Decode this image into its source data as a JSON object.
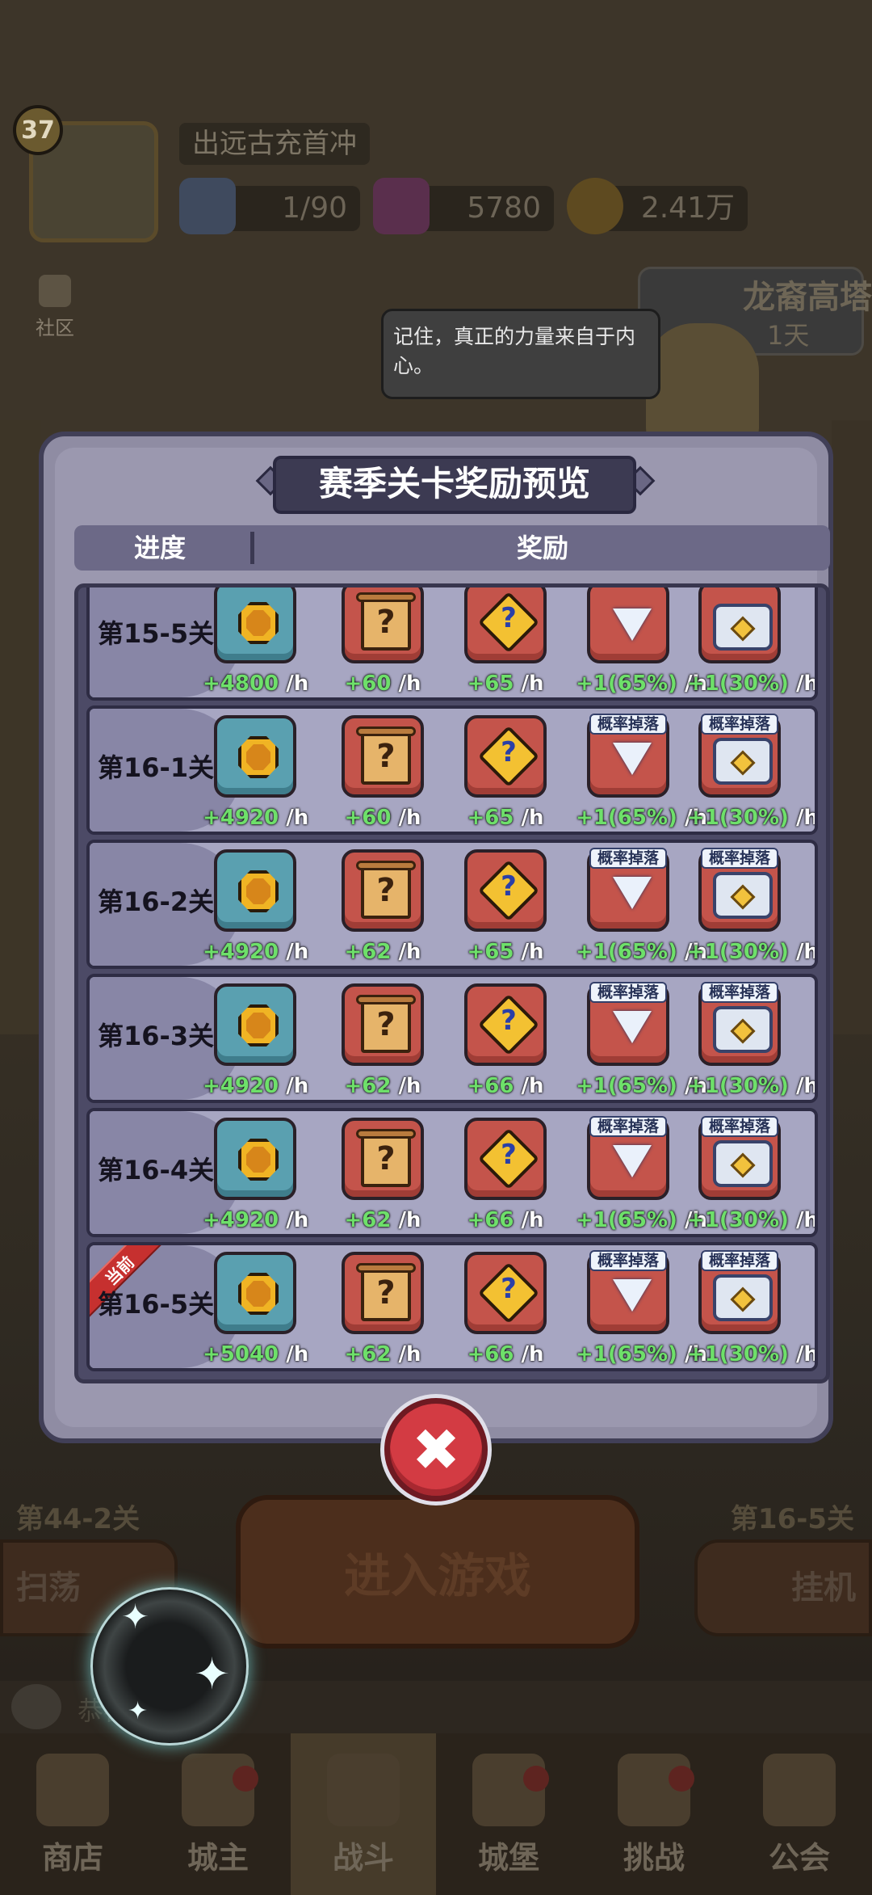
{
  "background": {
    "player_level": "37",
    "player_name": "出远古充首冲",
    "energy": "1/90",
    "gems": "5780",
    "gold": "2.41万",
    "community_label": "社区",
    "tower_name": "龙裔高塔",
    "tower_days": "1天",
    "speech": "记住，真正的力量来自于内心。",
    "stage_left": "第44-2关",
    "stage_right": "第16-5关",
    "sweep_label": "扫荡",
    "enter_label": "进入游戏",
    "idle_label": "挂机",
    "chat_text": "恭喜...新纪元"
  },
  "modal": {
    "title": "赛季关卡奖励预览",
    "col_progress": "进度",
    "col_reward": "奖励",
    "prob_tag": "概率掉落",
    "unit": "/h",
    "current_tag": "当前",
    "rows": [
      {
        "stage": "第15-5关",
        "gold": "+4800",
        "scroll": "+60",
        "puzzle": "+65",
        "gem": "+1(65%)",
        "chest": "+1(30%)"
      },
      {
        "stage": "第16-1关",
        "gold": "+4920",
        "scroll": "+60",
        "puzzle": "+65",
        "gem": "+1(65%)",
        "chest": "+1(30%)"
      },
      {
        "stage": "第16-2关",
        "gold": "+4920",
        "scroll": "+62",
        "puzzle": "+65",
        "gem": "+1(65%)",
        "chest": "+1(30%)"
      },
      {
        "stage": "第16-3关",
        "gold": "+4920",
        "scroll": "+62",
        "puzzle": "+66",
        "gem": "+1(65%)",
        "chest": "+1(30%)"
      },
      {
        "stage": "第16-4关",
        "gold": "+4920",
        "scroll": "+62",
        "puzzle": "+66",
        "gem": "+1(65%)",
        "chest": "+1(30%)"
      },
      {
        "stage": "第16-5关",
        "gold": "+5040",
        "scroll": "+62",
        "puzzle": "+66",
        "gem": "+1(65%)",
        "chest": "+1(30%)"
      }
    ]
  },
  "nav": [
    {
      "label": "商店",
      "icon": "shop-icon"
    },
    {
      "label": "城主",
      "icon": "crown-icon"
    },
    {
      "label": "战斗",
      "icon": "swords-icon"
    },
    {
      "label": "城堡",
      "icon": "castle-icon"
    },
    {
      "label": "挑战",
      "icon": "challenge-icon"
    },
    {
      "label": "公会",
      "icon": "guild-icon"
    }
  ],
  "close_glyph": "✖"
}
